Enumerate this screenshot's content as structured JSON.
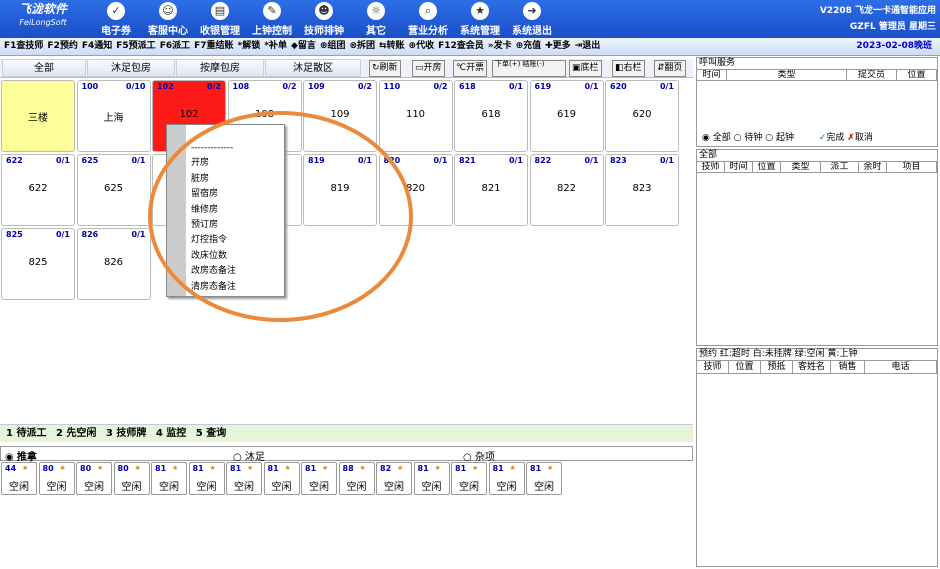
{
  "app": {
    "logo_cn": "飞泷软件",
    "logo_en": "FeiLongSoft",
    "top_right_line1": "V2208 飞龙一卡通智能应用",
    "top_right_line2": "GZFL 管理员 星期三"
  },
  "top_menu": [
    {
      "label": "电子券",
      "icon": "✓"
    },
    {
      "label": "客服中心",
      "icon": "☺"
    },
    {
      "label": "收银管理",
      "icon": "▤"
    },
    {
      "label": "上钟控制",
      "icon": "✎"
    },
    {
      "label": "技师排钟",
      "icon": "☻"
    },
    {
      "label": "其它",
      "icon": "☼"
    },
    {
      "label": "营业分析",
      "icon": "⌕"
    },
    {
      "label": "系统管理",
      "icon": "★"
    },
    {
      "label": "系统退出",
      "icon": "➜"
    }
  ],
  "toolbar": {
    "items": [
      "F1查技师",
      "F2预约",
      "F4通知",
      "F5预派工",
      "F6派工",
      "F7重结账",
      "*解锁",
      "*补单",
      "◆留言",
      "⊕组团",
      "⊗拆团",
      "⇆转账",
      "⊕代收",
      "F12查会员",
      "»发卡",
      "⊕充值",
      "✚更多",
      "⇥退出"
    ],
    "date": "2023-02-08晚班"
  },
  "tabs": [
    "全部",
    "沐足包房",
    "按摩包房",
    "沐足散区"
  ],
  "tab_buttons": [
    "刷新",
    "开房",
    "开票",
    "下单(+) 结账(-)",
    "底栏",
    "右栏",
    "翻页"
  ],
  "rooms": [
    {
      "no": "",
      "occ": "",
      "name": "三楼",
      "color": "#ffff99"
    },
    {
      "no": "100",
      "occ": "0/10",
      "name": "上海",
      "color": "#ffffff"
    },
    {
      "no": "102",
      "occ": "0/2",
      "name": "102",
      "color": "#ff1a1a"
    },
    {
      "no": "108",
      "occ": "0/2",
      "name": "108",
      "color": "#ffffff"
    },
    {
      "no": "109",
      "occ": "0/2",
      "name": "109",
      "color": "#ffffff"
    },
    {
      "no": "110",
      "occ": "0/2",
      "name": "110",
      "color": "#ffffff"
    },
    {
      "no": "618",
      "occ": "0/1",
      "name": "618",
      "color": "#ffffff"
    },
    {
      "no": "619",
      "occ": "0/1",
      "name": "619",
      "color": "#ffffff"
    },
    {
      "no": "620",
      "occ": "0/1",
      "name": "620",
      "color": "#ffffff"
    },
    {
      "no": "622",
      "occ": "0/1",
      "name": "622",
      "color": "#ffffff"
    },
    {
      "no": "625",
      "occ": "0/1",
      "name": "625",
      "color": "#ffffff"
    },
    {
      "no": "",
      "occ": "",
      "name": "",
      "color": "#ffffff"
    },
    {
      "no": "",
      "occ": "",
      "name": "",
      "color": "#ffffff"
    },
    {
      "no": "819",
      "occ": "0/1",
      "name": "819",
      "color": "#ffffff"
    },
    {
      "no": "820",
      "occ": "0/1",
      "name": "820",
      "color": "#ffffff"
    },
    {
      "no": "821",
      "occ": "0/1",
      "name": "821",
      "color": "#ffffff"
    },
    {
      "no": "822",
      "occ": "0/1",
      "name": "822",
      "color": "#ffffff"
    },
    {
      "no": "823",
      "occ": "0/1",
      "name": "823",
      "color": "#ffffff"
    },
    {
      "no": "825",
      "occ": "0/1",
      "name": "825",
      "color": "#ffffff"
    },
    {
      "no": "826",
      "occ": "0/1",
      "name": "826",
      "color": "#ffffff"
    }
  ],
  "context_menu": [
    "-------------",
    "开房",
    "脏房",
    "留宿房",
    "维修房",
    "预订房",
    "灯控指令",
    "改床位数",
    "改房态备注",
    "清房态备注"
  ],
  "bottom_tabs": [
    "1 待派工",
    "2 先空闲",
    "3 技师牌",
    "4 监控",
    "5 查询"
  ],
  "categories": [
    "推拿",
    "沐足",
    "杂项"
  ],
  "technicians": [
    {
      "no": "44",
      "status": "空闲"
    },
    {
      "no": "80",
      "status": "空闲"
    },
    {
      "no": "80",
      "status": "空闲"
    },
    {
      "no": "80",
      "status": "空闲"
    },
    {
      "no": "81",
      "status": "空闲"
    },
    {
      "no": "81",
      "status": "空闲"
    },
    {
      "no": "81",
      "status": "空闲"
    },
    {
      "no": "81",
      "status": "空闲"
    },
    {
      "no": "81",
      "status": "空闲"
    },
    {
      "no": "88",
      "status": "空闲"
    },
    {
      "no": "82",
      "status": "空闲"
    },
    {
      "no": "81",
      "status": "空闲"
    },
    {
      "no": "81",
      "status": "空闲"
    },
    {
      "no": "81",
      "status": "空闲"
    },
    {
      "no": "81",
      "status": "空闲"
    }
  ],
  "right": {
    "call_title": "呼叫服务",
    "call_cols": [
      "时间",
      "类型",
      "提交员",
      "位置"
    ],
    "call_opts": [
      "全部",
      "待钟",
      "起钟"
    ],
    "done": "完成",
    "cancel": "取消",
    "all_title": "全部",
    "all_cols": [
      "技师",
      "时间",
      "位置",
      "类型",
      "派工",
      "余时",
      "项目"
    ],
    "legend": "预约 红:超时 白:未挂牌 绿:空闲 黄:上钟",
    "res_cols": [
      "技师",
      "位置",
      "预抵",
      "客姓名",
      "销售",
      "电话"
    ]
  }
}
